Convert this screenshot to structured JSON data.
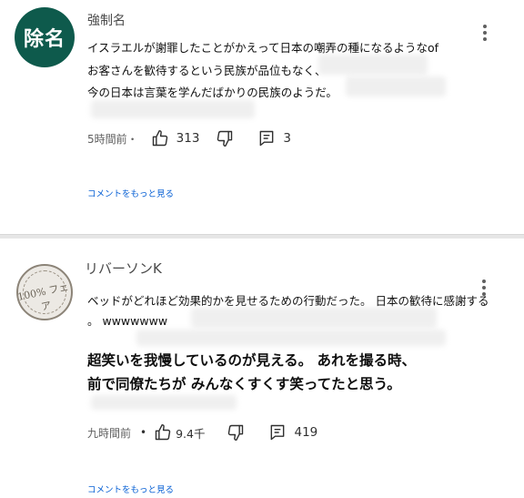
{
  "comments": [
    {
      "avatar_text": "除名",
      "username": "強制名",
      "lines": [
        "イスラエルが謝罪したことがかえって日本の嘲弄の種になるようなof",
        "お客さんを歓待するという民族が品位もなく、",
        "今の日本は言葉を学んだばかりの民族のようだ。"
      ],
      "time": "5時間前・",
      "likes": "313",
      "replies": "3",
      "more_label": "コメントをもっと見る"
    },
    {
      "avatar_text": "100% フェア",
      "username": "リバーソンK",
      "lines": [
        "ベッドがどれほど効果的かを見せるための行動だった。 日本の歓待に感謝する",
        "。 wwwwwww"
      ],
      "big_lines": [
        "超笑いを我慢しているのが見える。 あれを撮る時、",
        "前で同僚たちが みんなくすくす笑ってたと思う。"
      ],
      "time": "九時間前",
      "likes": "9.4千",
      "replies": "419",
      "more_label": "コメントをもっと見る"
    }
  ],
  "icons": {
    "like": "thumbs-up-icon",
    "dislike": "thumbs-down-icon",
    "reply": "comment-icon",
    "menu": "more-vert-icon"
  }
}
